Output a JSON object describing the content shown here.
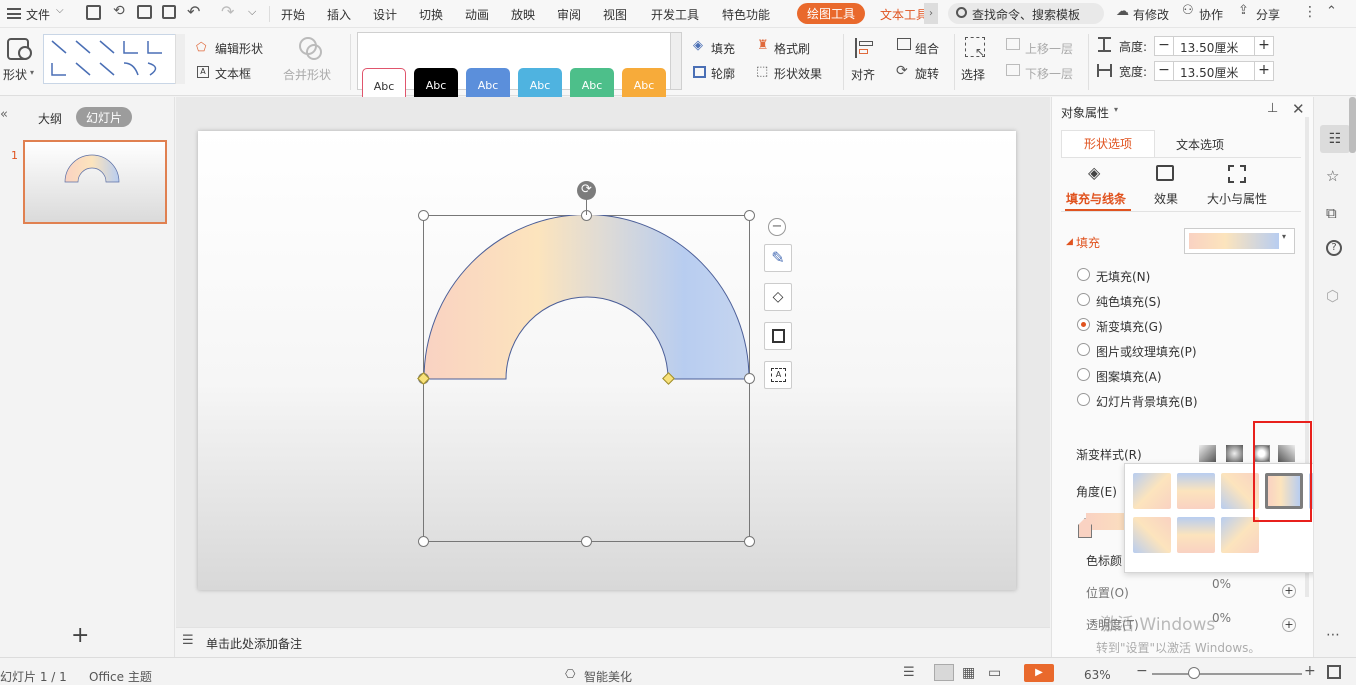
{
  "menubar": {
    "file_label": "文件",
    "tabs": [
      "开始",
      "插入",
      "设计",
      "切换",
      "动画",
      "放映",
      "审阅",
      "视图",
      "开发工具",
      "特色功能"
    ],
    "active_tab": "绘图工具",
    "text_tool": "文本工具",
    "search_placeholder": "查找命令、搜索模板",
    "has_changes": "有修改",
    "collab": "协作",
    "share": "分享"
  },
  "ribbon": {
    "shape": "形状",
    "edit_shape": "编辑形状",
    "text_box": "文本框",
    "merge_shape": "合并形状",
    "style_samples": [
      {
        "label": "Abc",
        "bg": "#ffffff",
        "fg": "#333333",
        "border": "#e0556c"
      },
      {
        "label": "Abc",
        "bg": "#000000",
        "fg": "#ffffff",
        "border": "#000000"
      },
      {
        "label": "Abc",
        "bg": "#5b8fdb",
        "fg": "#ffffff",
        "border": "#4a7ccc"
      },
      {
        "label": "Abc",
        "bg": "#4fb3e0",
        "fg": "#ffffff",
        "border": "#3aa2d0"
      },
      {
        "label": "Abc",
        "bg": "#4dbf8a",
        "fg": "#ffffff",
        "border": "#3caf79"
      },
      {
        "label": "Abc",
        "bg": "#f7ab3a",
        "fg": "#ffffff",
        "border": "#e89a2a"
      }
    ],
    "fill": "填充",
    "format_painter": "格式刷",
    "outline": "轮廓",
    "shape_effects": "形状效果",
    "align": "对齐",
    "group": "组合",
    "rotate": "旋转",
    "select": "选择",
    "bring_forward": "上移一层",
    "send_backward": "下移一层",
    "height_label": "高度:",
    "height_value": "13.50厘米",
    "width_label": "宽度:",
    "width_value": "13.50厘米"
  },
  "left_pane": {
    "tab_outline": "大纲",
    "tab_slides": "幻灯片",
    "slide_number": "1"
  },
  "notes": {
    "placeholder": "单击此处添加备注"
  },
  "right_pane": {
    "title": "对象属性",
    "tab_shape": "形状选项",
    "tab_text": "文本选项",
    "sub_fill_line": "填充与线条",
    "sub_effects": "效果",
    "sub_size": "大小与属性",
    "fill_section": "填充",
    "options": [
      {
        "label": "无填充(N)",
        "selected": false
      },
      {
        "label": "纯色填充(S)",
        "selected": false
      },
      {
        "label": "渐变填充(G)",
        "selected": true
      },
      {
        "label": "图片或纹理填充(P)",
        "selected": false
      },
      {
        "label": "图案填充(A)",
        "selected": false
      },
      {
        "label": "幻灯片背景填充(B)",
        "selected": false
      }
    ],
    "gradient_style": "渐变样式(R)",
    "angle": "角度(E)",
    "stop_color": "色标颜",
    "position": "位置(O)",
    "transparency": "透明度(T)",
    "percent_1": "0%",
    "percent_2": "0%",
    "watermark_1": "激活 Windows",
    "watermark_2": "转到\"设置\"以激活 Windows。"
  },
  "gradient": {
    "stop_1": "#f9d2c2",
    "stop_2": "#fce4bd",
    "stop_3": "#b8cdf0"
  },
  "statusbar": {
    "slide_info": "幻灯片 1 / 1",
    "theme": "Office 主题",
    "beautify": "智能美化",
    "zoom": "63%"
  }
}
